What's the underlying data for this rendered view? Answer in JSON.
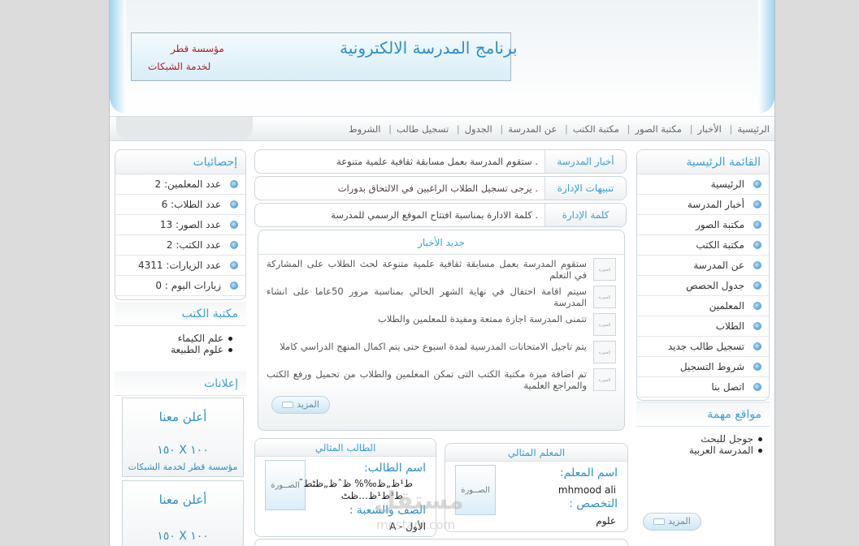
{
  "header": {
    "title": "برنامج المدرسة الالكترونية",
    "org_line1": "مؤسسة قطر",
    "org_line2": "لخدمة الشبكات"
  },
  "nav": {
    "items": [
      "الرئيسية",
      "الأخبار",
      "مكتبة الصور",
      "مكتبة الكتب",
      "عن المدرسة",
      "الجدول",
      "تسجيل طالب",
      "الشروط"
    ]
  },
  "main_menu": {
    "title": "القائمة الرئيسية",
    "items": [
      "الرئيسية",
      "أخبار المدرسة",
      "مكتبة الصور",
      "مكتبة الكتب",
      "عن المدرسة",
      "جدول الحصص",
      "المعلمين",
      "الطلاب",
      "تسجيل طالب جديد",
      "شروط التسجيل",
      "اتصل بنا"
    ]
  },
  "important_sites": {
    "title": "مواقع مهمة",
    "items": [
      "جوجل للبحث",
      "المدرسة العربية"
    ]
  },
  "right_more": "المزيد",
  "ticker": [
    {
      "label": "أخبار المدرسة",
      "text": ".   ستقوم المدرسة بعمل مسابقة ثقافية علمية متنوعة"
    },
    {
      "label": "تنبيهات الإدارة",
      "text": ".   يرجى تسجيل الطلاب الراغبين في الالتحاق بدورات"
    },
    {
      "label": "كلمة الإدارة",
      "text": ".   كلمة الادارة بمناسبة افتتاح الموقع الرسمي للمدرسة"
    }
  ],
  "latest_news": {
    "title": "جديد الأخبار",
    "thumb": "الصورة",
    "items": [
      "ستقوم المدرسة بعمل مسابقة ثقافية علمية متنوعة لحث الطلاب على المشاركة في التعلم",
      "سيتم اقامة احتفال في نهاية الشهر الحالي بمناسبة مرور 50عاما على انشاء المدرسة",
      "تتمنى المدرسة اجازة ممتعة ومفيدة للمعلمين والطلاب",
      "يتم تاجيل الامتحانات المدرسية لمدة اسبوع حتى يتم اكمال المنهج الدراسي كاملا",
      "تم اضافة ميزة مكتبة الكتب التى تمكن المعلمين والطلاب من تحميل ورفع الكتب والمراجع العلمية"
    ],
    "more": "المزيد"
  },
  "ideal_teacher": {
    "title": "المعلم المثالي",
    "photo": "الصــورة",
    "name_label": "اسم المعلم:",
    "name": "mhmood ali",
    "spec_label": "التخصص :",
    "spec": "علوم"
  },
  "ideal_student": {
    "title": "الطالب المثالي",
    "photo": "الصــورة",
    "name_label": "اسم الطالب:",
    "name_line1": "ط¹ظ„ظ‰% ظˆظ„ظٹط¯",
    "name_line2": "ط³ط¹ظ…ظٹ",
    "class_label": "الصف والشعبة :",
    "class": "الأول - A"
  },
  "stats": {
    "title": "إحصائيات",
    "items": [
      "عدد المعلمين: 2",
      "عدد الطلاب: 6",
      "عدد الصور: 13",
      "عدد الكتب: 2",
      "عدد الزيارات: 4311",
      "زيارات اليوم : 0"
    ]
  },
  "book_library": {
    "title": "مكتبة الكتب",
    "items": [
      "علم الكيماء",
      "علوم الطبيعة"
    ]
  },
  "ads": {
    "title": "إعلانات",
    "cards": [
      {
        "headline": "أعلن معنا",
        "size": "١٥٠ X ١٠٠",
        "org": "مؤسسة قطر لخدمة الشبكات"
      },
      {
        "headline": "أعلن معنا",
        "size": "١٥٠ X ١٠٠"
      }
    ]
  },
  "watermark": {
    "text": "مستقل",
    "domain": "mostaql.com"
  }
}
